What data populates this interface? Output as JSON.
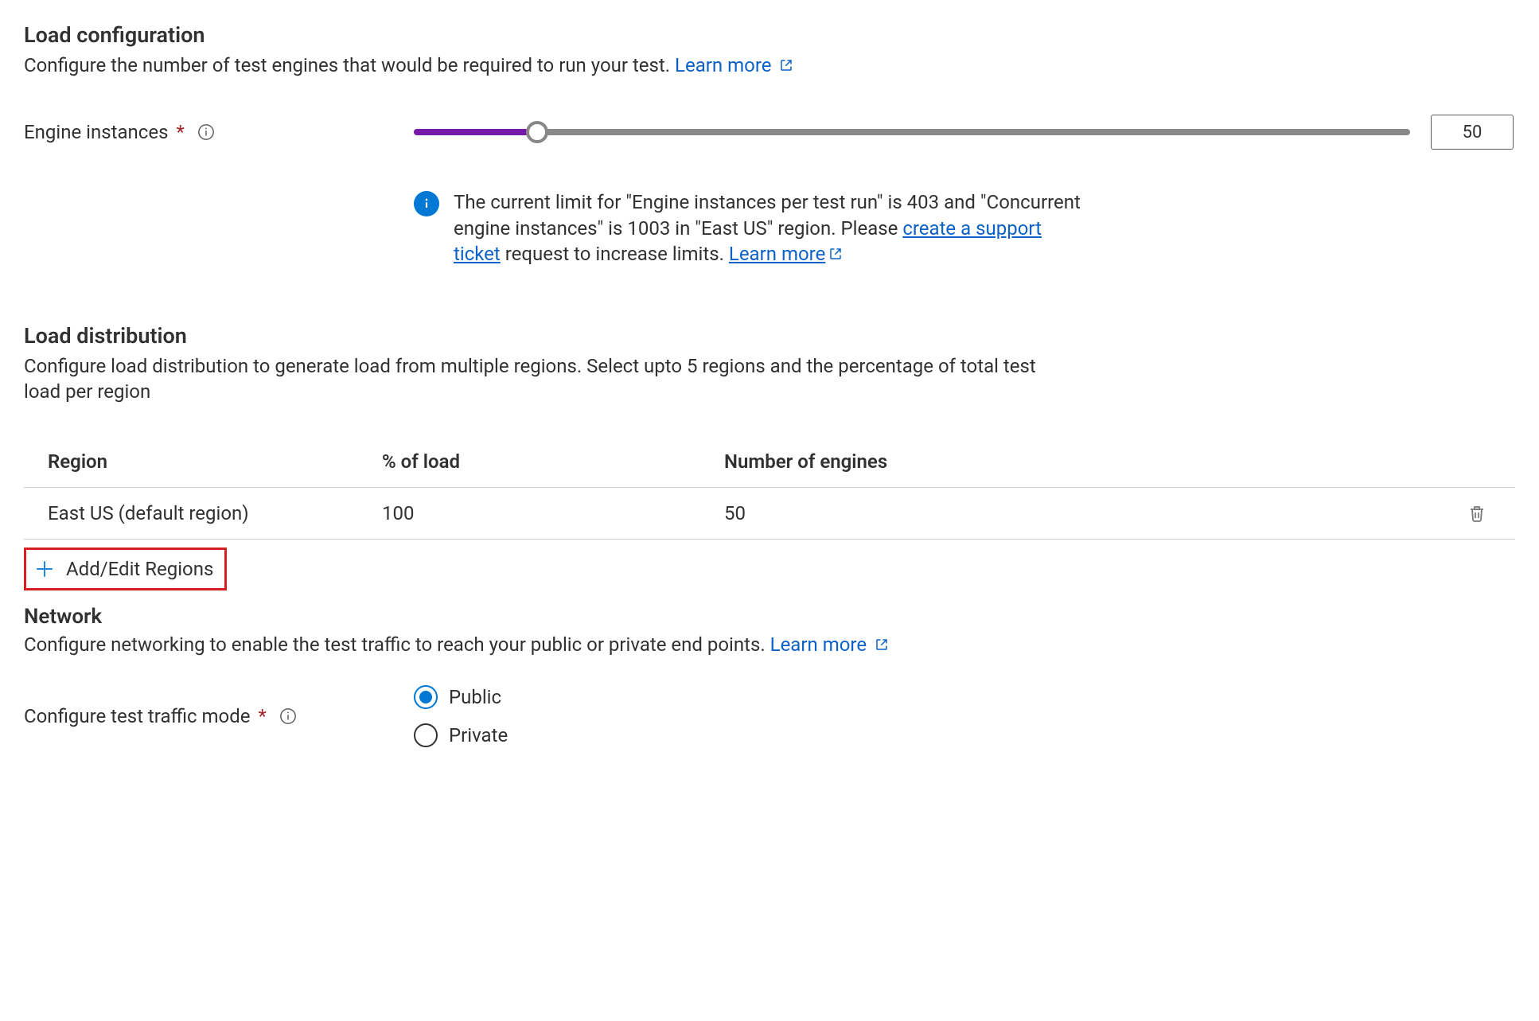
{
  "load_config": {
    "title": "Load configuration",
    "desc": "Configure the number of test engines that would be required to run your test.",
    "learn_more": "Learn more",
    "engines_label": "Engine instances",
    "engines_value": "50",
    "slider_percent": 12.4,
    "info_msg_a": "The current limit for \"Engine instances per test run\" is 403 and \"Concurrent engine instances\" is 1003 in \"East US\" region. Please ",
    "info_link_ticket": "create a support ticket",
    "info_msg_b": " request to increase limits. ",
    "info_link_learn": "Learn more"
  },
  "load_dist": {
    "title": "Load distribution",
    "desc": "Configure load distribution to generate load from multiple regions. Select upto 5 regions and the percentage of total test load per region",
    "col_region": "Region",
    "col_pct": "% of load",
    "col_engines": "Number of engines",
    "rows": [
      {
        "region": "East US (default region)",
        "pct": "100",
        "engines": "50"
      }
    ],
    "add_edit": "Add/Edit Regions"
  },
  "network": {
    "title": "Network",
    "desc": "Configure networking to enable the test traffic to reach your public or private end points.",
    "learn_more": "Learn more",
    "traffic_label": "Configure test traffic mode",
    "opt_public": "Public",
    "opt_private": "Private",
    "selected": "public"
  }
}
